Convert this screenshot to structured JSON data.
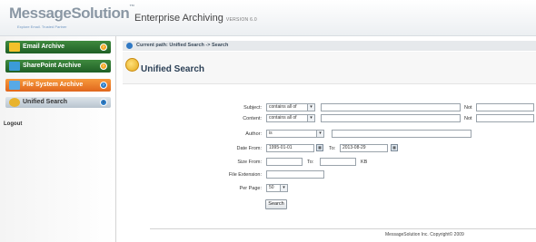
{
  "header": {
    "logo": "MessageSolution",
    "logo_tm": "™",
    "tagline": "Explore Email. Trusted Partner",
    "app_title": "Enterprise Archiving",
    "version": "VERSION 6.0"
  },
  "sidebar": {
    "items": [
      {
        "label": "Email Archive",
        "icon": "folder-icon"
      },
      {
        "label": "SharePoint Archive",
        "icon": "sharepoint-icon"
      },
      {
        "label": "File System Archive",
        "icon": "file-system-icon"
      },
      {
        "label": "Unified Search",
        "icon": "search-icon"
      }
    ],
    "logout": "Logout"
  },
  "path": {
    "text": "Current path: Unified Search -> Search"
  },
  "page": {
    "title": "Unified Search"
  },
  "form": {
    "subject_label": "Subject:",
    "subject_op": "contains all of",
    "content_label": "Content:",
    "content_op": "contains all of",
    "not_label": "Not",
    "author_label": "Author:",
    "author_op": "is",
    "date_from_label": "Date From:",
    "date_from": "1995-01-01",
    "date_to_label": "To:",
    "date_to": "2013-08-29",
    "size_from_label": "Size From:",
    "size_to_label": "To:",
    "size_unit": "KB",
    "file_ext_label": "File Extension:",
    "per_page_label": "Per Page:",
    "per_page": "50",
    "search_button": "Search"
  },
  "footer": {
    "copyright": "MessageSolution Inc. Copyright© 2009"
  }
}
